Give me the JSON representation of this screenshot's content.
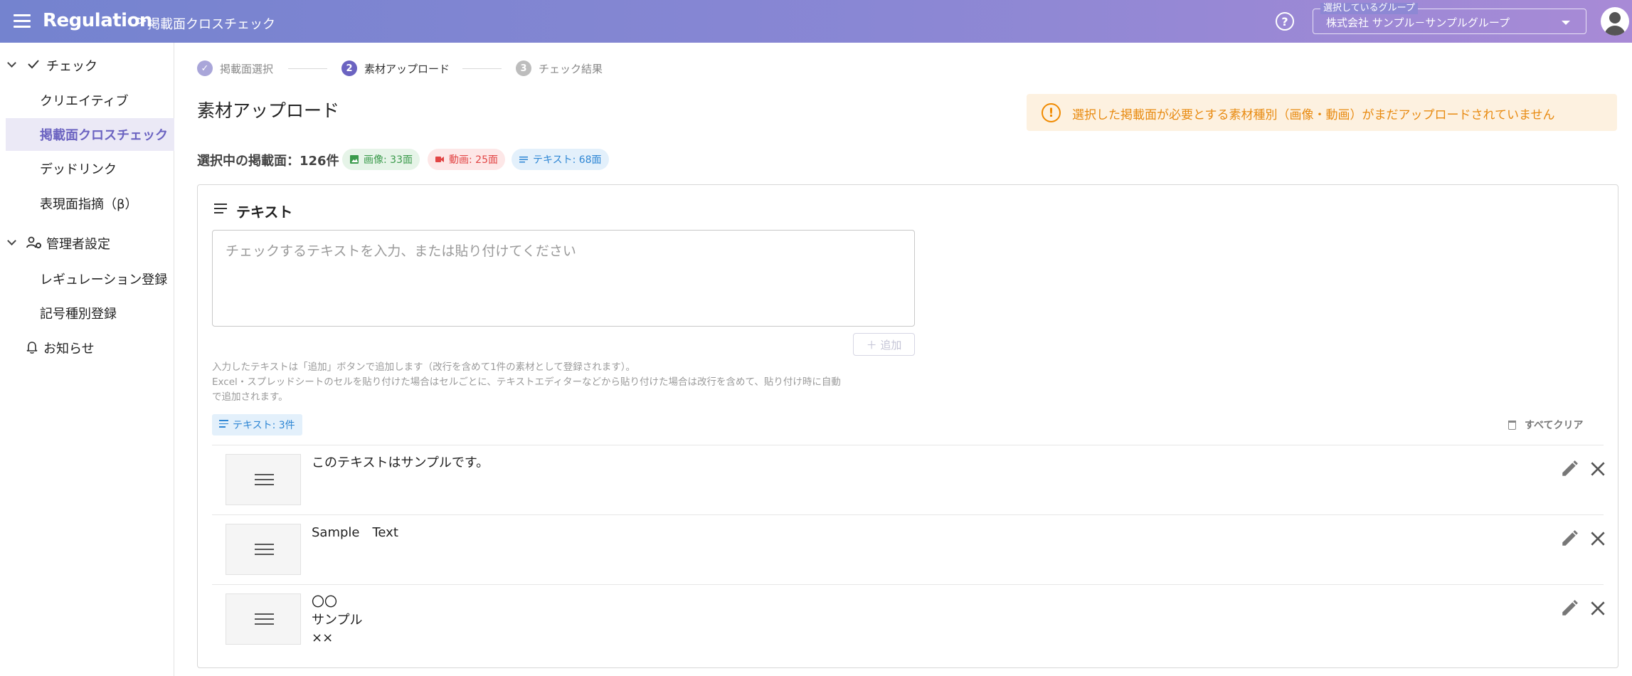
{
  "header": {
    "brand": "Regulation",
    "separator": ">",
    "subtitle": "掲載面クロスチェック",
    "help_glyph": "?",
    "group_label": "選択しているグループ",
    "group_value": "株式会社 サンプル－サンプルグループ"
  },
  "sidebar": {
    "check_group": "チェック",
    "check_items": [
      "クリエイティブ",
      "掲載面クロスチェック",
      "デッドリンク",
      "表現面指摘（β）"
    ],
    "admin_group": "管理者設定",
    "admin_items": [
      "レギュレーション登録",
      "記号種別登録"
    ],
    "notifications": "お知らせ"
  },
  "stepper": {
    "steps": [
      {
        "number": "✓",
        "label": "掲載面選択",
        "state": "done"
      },
      {
        "number": "2",
        "label": "素材アップロード",
        "state": "active"
      },
      {
        "number": "3",
        "label": "チェック結果",
        "state": "pending"
      }
    ]
  },
  "main": {
    "title": "素材アップロード",
    "alert_glyph": "!",
    "alert": "選択した掲載面が必要とする素材種別（画像・動画）がまだアップロードされていません",
    "selected_label": "選択中の掲載面：126件",
    "chips": {
      "image": "画像: 33面",
      "video": "動画: 25面",
      "text": "テキスト: 68面"
    }
  },
  "panel": {
    "title": "テキスト",
    "placeholder": "チェックするテキストを入力、または貼り付けてください",
    "add_label": "＋ 追加",
    "help_line1": "入力したテキストは「追加」ボタンで追加します（改行を含めて1件の素材として登録されます）。",
    "help_line2": "Excel・スプレッドシートのセルを貼り付けた場合はセルごとに、テキストエディターなどから貼り付けた場合は改行を含めて、貼り付け時に自動",
    "help_line3": "で追加されます。",
    "count_label": "テキスト: 3件",
    "clear_all": "すべてクリア",
    "items": [
      {
        "text": "このテキストはサンプルです。"
      },
      {
        "text": "Sample　Text"
      },
      {
        "text": "〇〇\nサンプル\n××"
      }
    ]
  },
  "colors": {
    "header_start": "#7483cf",
    "header_end": "#a88ad6",
    "accent": "#6b63c1",
    "active_bg": "#ebe9f6",
    "alert_bg": "#fdf1e0",
    "alert_text": "#e88a10",
    "chip_image_bg": "#e6f4e8",
    "chip_image_text": "#3a9a4b",
    "chip_video_bg": "#fde7e7",
    "chip_video_text": "#e24545",
    "chip_text_bg": "#e3f0fb",
    "chip_text_text": "#2e86d4"
  }
}
